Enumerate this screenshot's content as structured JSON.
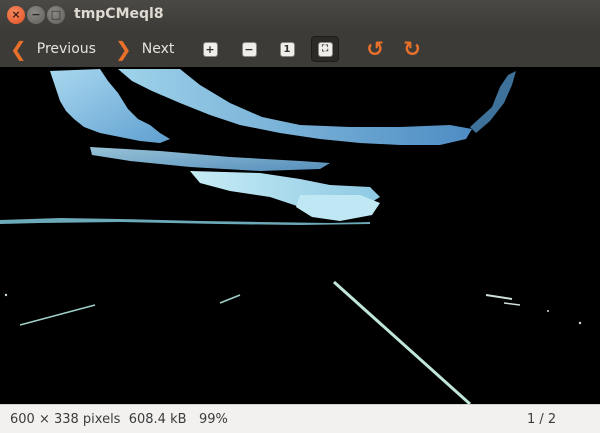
{
  "window": {
    "title": "tmpCMeql8",
    "close_glyph": "×",
    "minimize_glyph": "−",
    "maximize_glyph": "□"
  },
  "toolbar": {
    "previous_label": "Previous",
    "next_label": "Next",
    "zoom_in_icon": "zoom-in-icon",
    "zoom_out_icon": "zoom-out-icon",
    "zoom_normal_icon": "zoom-normal-icon",
    "best_fit_icon": "best-fit-icon",
    "rotate_left_icon": "rotate-left-icon",
    "rotate_right_icon": "rotate-right-icon",
    "accent_color": "#e8702a"
  },
  "status": {
    "dimensions": "600 × 338 pixels",
    "file_size": "608.4 kB",
    "zoom": "99%",
    "page_position": "1 / 2"
  }
}
